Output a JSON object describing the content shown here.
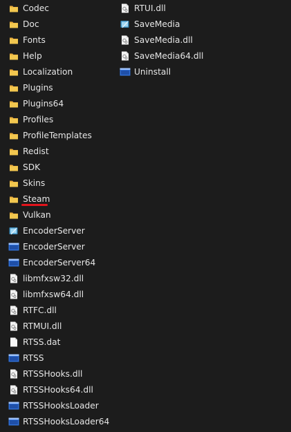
{
  "columns": [
    {
      "items": [
        {
          "label": "Codec",
          "icon": "folder-icon"
        },
        {
          "label": "Doc",
          "icon": "folder-icon"
        },
        {
          "label": "Fonts",
          "icon": "folder-icon"
        },
        {
          "label": "Help",
          "icon": "folder-icon"
        },
        {
          "label": "Localization",
          "icon": "folder-icon"
        },
        {
          "label": "Plugins",
          "icon": "folder-icon"
        },
        {
          "label": "Plugins64",
          "icon": "folder-icon"
        },
        {
          "label": "Profiles",
          "icon": "folder-icon"
        },
        {
          "label": "ProfileTemplates",
          "icon": "folder-icon"
        },
        {
          "label": "Redist",
          "icon": "folder-icon"
        },
        {
          "label": "SDK",
          "icon": "folder-icon"
        },
        {
          "label": "Skins",
          "icon": "folder-icon"
        },
        {
          "label": "Steam",
          "icon": "folder-icon"
        },
        {
          "label": "Vulkan",
          "icon": "folder-icon"
        },
        {
          "label": "EncoderServer",
          "icon": "app-icon"
        },
        {
          "label": "EncoderServer",
          "icon": "exe-window-icon"
        },
        {
          "label": "EncoderServer64",
          "icon": "exe-window-icon"
        },
        {
          "label": "libmfxsw32.dll",
          "icon": "dll-file-icon"
        },
        {
          "label": "libmfxsw64.dll",
          "icon": "dll-file-icon"
        },
        {
          "label": "RTFC.dll",
          "icon": "dll-file-icon"
        },
        {
          "label": "RTMUI.dll",
          "icon": "dll-file-icon"
        },
        {
          "label": "RTSS.dat",
          "icon": "blank-file-icon"
        },
        {
          "label": "RTSS",
          "icon": "exe-window-icon"
        },
        {
          "label": "RTSSHooks.dll",
          "icon": "dll-file-icon"
        },
        {
          "label": "RTSSHooks64.dll",
          "icon": "dll-file-icon"
        },
        {
          "label": "RTSSHooksLoader",
          "icon": "exe-window-icon"
        },
        {
          "label": "RTSSHooksLoader64",
          "icon": "exe-window-icon"
        }
      ]
    },
    {
      "items": [
        {
          "label": "RTUI.dll",
          "icon": "dll-file-icon"
        },
        {
          "label": "SaveMedia",
          "icon": "app-icon"
        },
        {
          "label": "SaveMedia.dll",
          "icon": "dll-file-icon"
        },
        {
          "label": "SaveMedia64.dll",
          "icon": "dll-file-icon"
        },
        {
          "label": "Uninstall",
          "icon": "exe-window-icon"
        }
      ]
    }
  ],
  "highlight": {
    "item": "Steam",
    "color": "#e3141c"
  },
  "colors": {
    "background": "#1c1c1c",
    "text": "#e6e6e6",
    "folder": "#f2c74f",
    "exe_blue": "#2f6fd6"
  }
}
